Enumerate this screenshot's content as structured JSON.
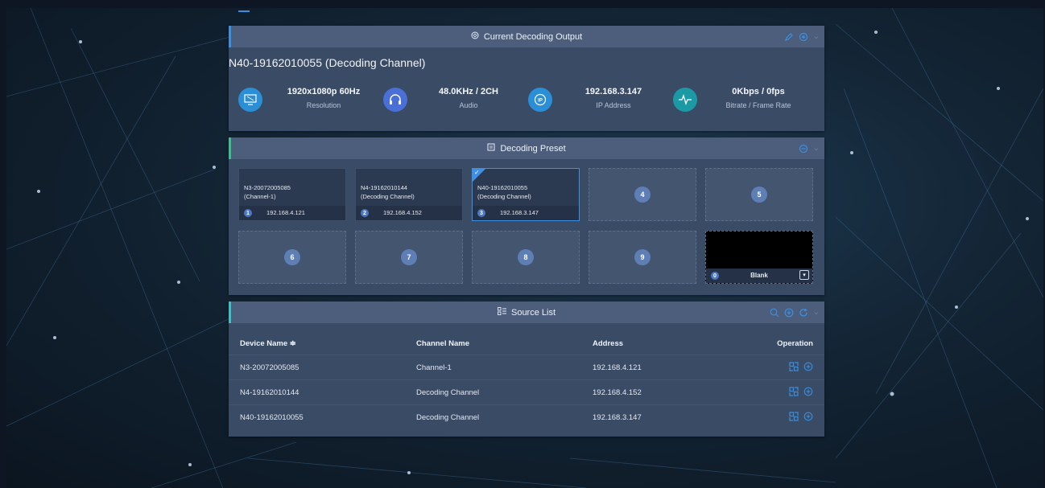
{
  "output": {
    "title": "Current Decoding Output",
    "device_name": "N40-19162010055 (Decoding Channel)",
    "stats": [
      {
        "value": "1920x1080p 60Hz",
        "label": "Resolution",
        "icon": "monitor-icon",
        "color": "#2a8fd6"
      },
      {
        "value": "48.0KHz / 2CH",
        "label": "Audio",
        "icon": "headphones-icon",
        "color": "#4a6fd6"
      },
      {
        "value": "192.168.3.147",
        "label": "IP Address",
        "icon": "ip-icon",
        "color": "#2a8fd6"
      },
      {
        "value": "0Kbps / 0fps",
        "label": "Bitrate / Frame Rate",
        "icon": "waveform-icon",
        "color": "#1b9aa6"
      }
    ]
  },
  "preset": {
    "title": "Decoding Preset",
    "cards": [
      {
        "num": "1",
        "device": "N3-20072005085",
        "channel": "(Channel-1)",
        "ip": "192.168.4.121"
      },
      {
        "num": "2",
        "device": "N4-19162010144",
        "channel": "(Decoding Channel)",
        "ip": "192.168.4.152"
      },
      {
        "num": "3",
        "device": "N40-19162010055",
        "channel": "(Decoding Channel)",
        "ip": "192.168.3.147"
      }
    ],
    "empty": [
      "4",
      "5",
      "6",
      "7",
      "8",
      "9"
    ],
    "blank": {
      "num": "0",
      "label": "Blank"
    }
  },
  "source": {
    "title": "Source List",
    "headers": {
      "device": "Device Name ≑",
      "channel": "Channel Name",
      "address": "Address",
      "operation": "Operation"
    },
    "rows": [
      {
        "device": "N3-20072005085",
        "channel": "Channel-1",
        "address": "192.168.4.121"
      },
      {
        "device": "N4-19162010144",
        "channel": "Decoding Channel",
        "address": "192.168.4.152"
      },
      {
        "device": "N40-19162010055",
        "channel": "Decoding Channel",
        "address": "192.168.3.147"
      }
    ]
  },
  "colors": {
    "accent": "#3a8fe0",
    "panel": "#3a4b66",
    "header": "#4c5e7c"
  }
}
